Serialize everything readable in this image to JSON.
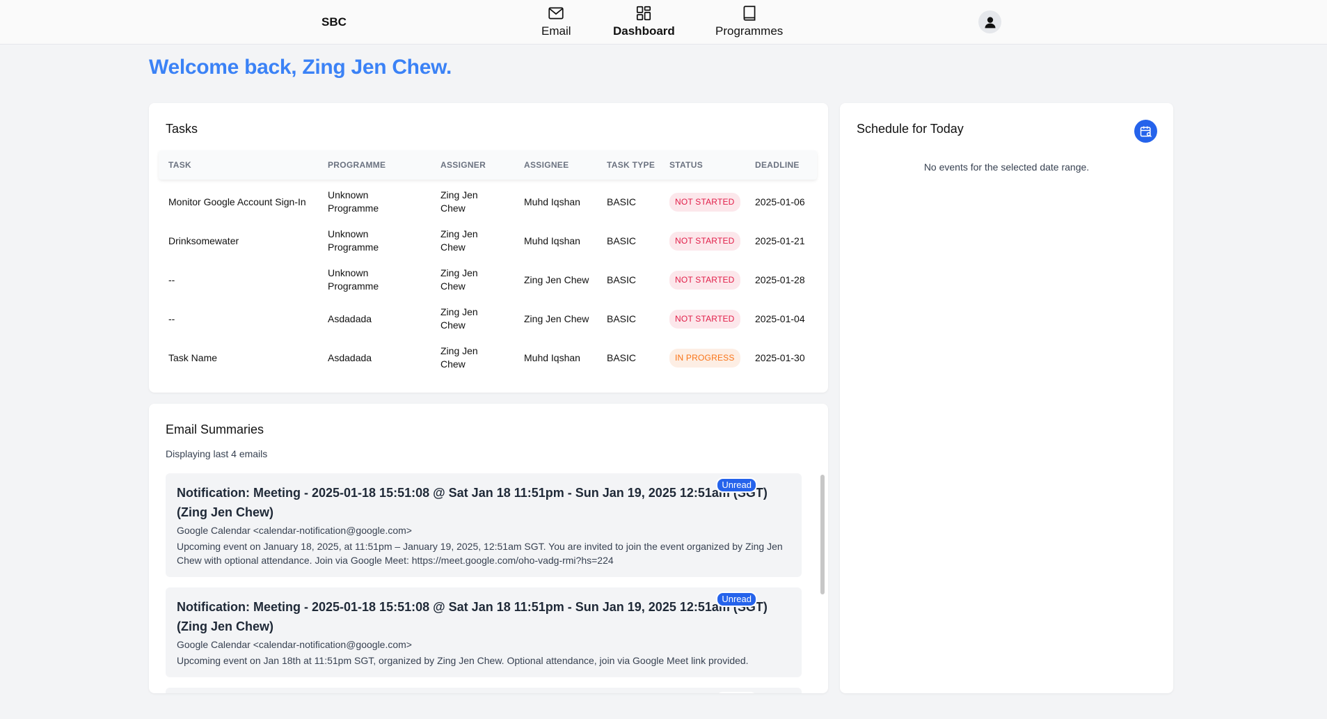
{
  "nav": {
    "brand": "SBC",
    "items": [
      {
        "label": "Email",
        "icon": "mail-icon"
      },
      {
        "label": "Dashboard",
        "icon": "dashboard-icon"
      },
      {
        "label": "Programmes",
        "icon": "book-icon"
      }
    ],
    "active": "Dashboard"
  },
  "welcome": "Welcome back, Zing Jen Chew.",
  "tasks": {
    "title": "Tasks",
    "columns": [
      "TASK",
      "PROGRAMME",
      "ASSIGNER",
      "ASSIGNEE",
      "TASK TYPE",
      "STATUS",
      "DEADLINE"
    ],
    "rows": [
      {
        "task": "Monitor Google Account Sign-In",
        "programme": "Unknown Programme",
        "assigner": "Zing Jen Chew",
        "assignee": "Muhd Iqshan",
        "type": "BASIC",
        "status": "NOT STARTED",
        "deadline": "2025-01-06"
      },
      {
        "task": "Drinksomewater",
        "programme": "Unknown Programme",
        "assigner": "Zing Jen Chew",
        "assignee": "Muhd Iqshan",
        "type": "BASIC",
        "status": "NOT STARTED",
        "deadline": "2025-01-21"
      },
      {
        "task": "--",
        "programme": "Unknown Programme",
        "assigner": "Zing Jen Chew",
        "assignee": "Zing Jen Chew",
        "type": "BASIC",
        "status": "NOT STARTED",
        "deadline": "2025-01-28"
      },
      {
        "task": "--",
        "programme": "Asdadada",
        "assigner": "Zing Jen Chew",
        "assignee": "Zing Jen Chew",
        "type": "BASIC",
        "status": "NOT STARTED",
        "deadline": "2025-01-04"
      },
      {
        "task": "Task Name",
        "programme": "Asdadada",
        "assigner": "Zing Jen Chew",
        "assignee": "Muhd Iqshan",
        "type": "BASIC",
        "status": "IN PROGRESS",
        "deadline": "2025-01-30"
      }
    ]
  },
  "emails": {
    "title": "Email Summaries",
    "subtitle": "Displaying last 4 emails",
    "items": [
      {
        "subject": "Notification: Meeting - 2025-01-18 15:51:08 @ Sat Jan 18 11:51pm - Sun Jan 19, 2025 12:51am (SGT) (Zing Jen Chew)",
        "from": "Google Calendar <calendar-notification@google.com>",
        "summary": "Upcoming event on January 18, 2025, at 11:51pm – January 19, 2025, 12:51am SGT. You are invited to join the event organized by Zing Jen Chew with optional attendance. Join via Google Meet: https://meet.google.com/oho-vadg-rmi?hs=224",
        "badge": "Unread"
      },
      {
        "subject": "Notification: Meeting - 2025-01-18 15:51:08 @ Sat Jan 18 11:51pm - Sun Jan 19, 2025 12:51am (SGT) (Zing Jen Chew)",
        "from": "Google Calendar <calendar-notification@google.com>",
        "summary": "Upcoming event on Jan 18th at 11:51pm SGT, organized by Zing Jen Chew. Optional attendance, join via Google Meet link provided.",
        "badge": "Unread"
      },
      {
        "subject": "",
        "from": "",
        "summary": "",
        "badge": "Unread"
      }
    ]
  },
  "schedule": {
    "title": "Schedule for Today",
    "empty": "No events for the selected date range."
  },
  "colors": {
    "accent": "#3b82f6",
    "not_started_bg": "#fce7eb",
    "not_started_fg": "#e11d48",
    "in_progress_bg": "#fdeee4",
    "in_progress_fg": "#f97316"
  }
}
